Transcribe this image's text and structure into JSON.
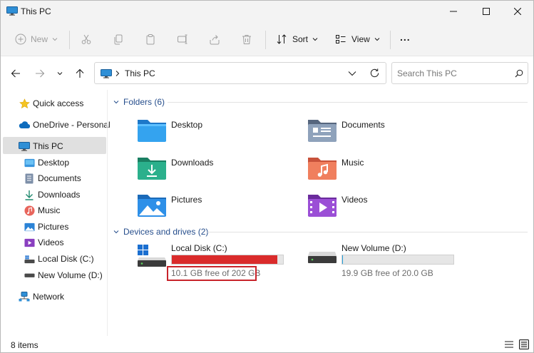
{
  "window": {
    "title": "This PC"
  },
  "toolbar": {
    "new_label": "New",
    "sort_label": "Sort",
    "view_label": "View",
    "more_label": "..."
  },
  "address": {
    "location": "This PC"
  },
  "search": {
    "placeholder": "Search This PC"
  },
  "sidebar": {
    "items": [
      {
        "label": "Quick access",
        "icon": "star-icon"
      },
      {
        "label": "OneDrive - Personal",
        "icon": "cloud-icon"
      },
      {
        "label": "This PC",
        "icon": "computer-icon",
        "selected": true
      },
      {
        "label": "Desktop",
        "icon": "desktop-folder-icon"
      },
      {
        "label": "Documents",
        "icon": "documents-icon"
      },
      {
        "label": "Downloads",
        "icon": "download-icon"
      },
      {
        "label": "Music",
        "icon": "music-icon"
      },
      {
        "label": "Pictures",
        "icon": "pictures-icon"
      },
      {
        "label": "Videos",
        "icon": "videos-icon"
      },
      {
        "label": "Local Disk (C:)",
        "icon": "drive-icon"
      },
      {
        "label": "New Volume (D:)",
        "icon": "drive-icon"
      },
      {
        "label": "Network",
        "icon": "network-icon"
      }
    ]
  },
  "folders": {
    "heading": "Folders (6)",
    "items": [
      {
        "name": "Desktop"
      },
      {
        "name": "Documents"
      },
      {
        "name": "Downloads"
      },
      {
        "name": "Music"
      },
      {
        "name": "Pictures"
      },
      {
        "name": "Videos"
      }
    ]
  },
  "drives": {
    "heading": "Devices and drives (2)",
    "items": [
      {
        "name": "Local Disk (C:)",
        "free_text": "10.1 GB free of 202 GB",
        "used_fraction": 0.95,
        "bar_color": "#da2b2b"
      },
      {
        "name": "New Volume (D:)",
        "free_text": "19.9 GB free of 20.0 GB",
        "used_fraction": 0.005,
        "bar_color": "#26a0da"
      }
    ]
  },
  "status": {
    "item_count": "8 items"
  },
  "colors": {
    "accent": "#0067c0",
    "warning_bar": "#da2b2b",
    "highlight_box": "#c8242b"
  }
}
